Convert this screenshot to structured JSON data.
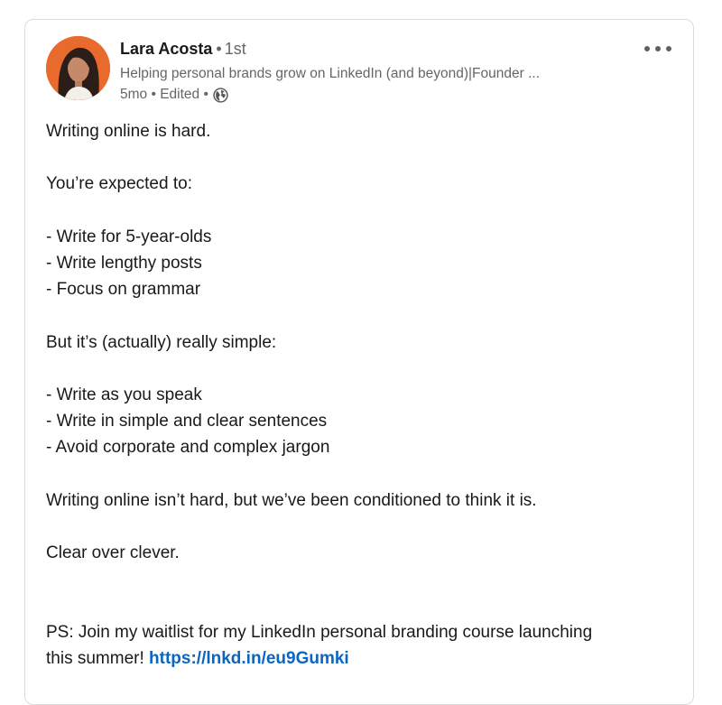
{
  "post": {
    "author": {
      "name": "Lara Acosta",
      "separator": "•",
      "degree": "1st",
      "headline": "Helping personal brands grow on LinkedIn (and beyond)|Founder ...",
      "meta": "5mo • Edited •",
      "visibility_icon": "globe-icon"
    },
    "more_icon": "ellipsis-icon",
    "lines": [
      "Writing online is hard.",
      "",
      "You’re expected to:",
      "",
      "- Write for 5-year-olds",
      "- Write lengthy posts",
      "- Focus on grammar",
      "",
      "But it’s (actually) really simple:",
      "",
      "- Write as you speak",
      "- Write in simple and clear sentences",
      "- Avoid corporate and complex jargon",
      "",
      "Writing online isn’t hard, but we’ve been conditioned to think it is.",
      "",
      "Clear over clever.",
      "",
      "",
      "PS: Join my waitlist for my LinkedIn personal branding course launching"
    ],
    "last_line_text": "this summer!",
    "link": "https://lnkd.in/eu9Gumki"
  },
  "colors": {
    "link": "#0a66c2",
    "text": "#191919",
    "muted": "#666666",
    "avatar_ring": "#e86a2c"
  }
}
